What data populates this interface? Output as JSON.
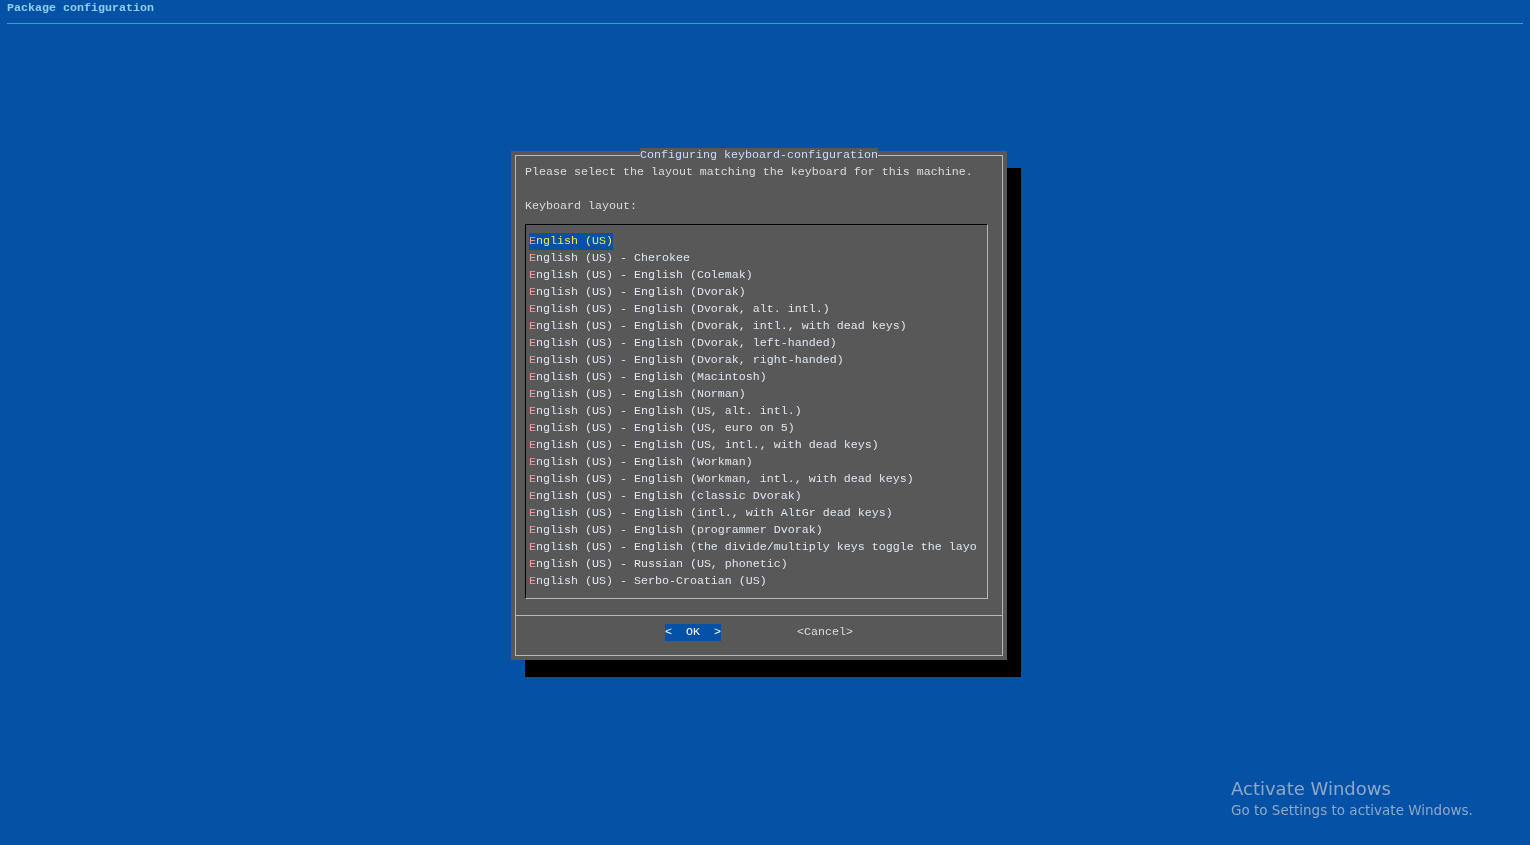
{
  "header": {
    "title": "Package configuration"
  },
  "dialog": {
    "title": "Configuring keyboard-configuration",
    "prompt": "Please select the layout matching the keyboard for this machine.",
    "label": "Keyboard layout:",
    "items": [
      {
        "text": "English (US)",
        "selected": true
      },
      {
        "text": "English (US) - Cherokee",
        "selected": false
      },
      {
        "text": "English (US) - English (Colemak)",
        "selected": false
      },
      {
        "text": "English (US) - English (Dvorak)",
        "selected": false
      },
      {
        "text": "English (US) - English (Dvorak, alt. intl.)",
        "selected": false
      },
      {
        "text": "English (US) - English (Dvorak, intl., with dead keys)",
        "selected": false
      },
      {
        "text": "English (US) - English (Dvorak, left-handed)",
        "selected": false
      },
      {
        "text": "English (US) - English (Dvorak, right-handed)",
        "selected": false
      },
      {
        "text": "English (US) - English (Macintosh)",
        "selected": false
      },
      {
        "text": "English (US) - English (Norman)",
        "selected": false
      },
      {
        "text": "English (US) - English (US, alt. intl.)",
        "selected": false
      },
      {
        "text": "English (US) - English (US, euro on 5)",
        "selected": false
      },
      {
        "text": "English (US) - English (US, intl., with dead keys)",
        "selected": false
      },
      {
        "text": "English (US) - English (Workman)",
        "selected": false
      },
      {
        "text": "English (US) - English (Workman, intl., with dead keys)",
        "selected": false
      },
      {
        "text": "English (US) - English (classic Dvorak)",
        "selected": false
      },
      {
        "text": "English (US) - English (intl., with AltGr dead keys)",
        "selected": false
      },
      {
        "text": "English (US) - English (programmer Dvorak)",
        "selected": false
      },
      {
        "text": "English (US) - English (the divide/multiply keys toggle the layo",
        "selected": false
      },
      {
        "text": "English (US) - Russian (US, phonetic)",
        "selected": false
      },
      {
        "text": "English (US) - Serbo-Croatian (US)",
        "selected": false
      }
    ],
    "buttons": [
      {
        "label": "<  OK  >",
        "selected": true
      },
      {
        "label": "<Cancel>",
        "selected": false
      }
    ]
  },
  "os_notice": {
    "title": "Activate Windows",
    "text": "Go to Settings to activate Windows."
  }
}
